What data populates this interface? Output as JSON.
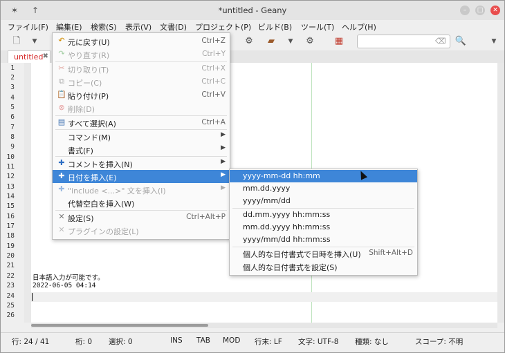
{
  "window": {
    "title": "*untitled - Geany"
  },
  "menubar": [
    "ファイル(F)",
    "編集(E)",
    "検索(S)",
    "表示(V)",
    "文書(D)",
    "プロジェクト(P)",
    "ビルド(B)",
    "ツール(T)",
    "ヘルプ(H)"
  ],
  "tab": {
    "label": "untitled",
    "close": "✖"
  },
  "search": {
    "value": ""
  },
  "editor": {
    "line_numbers": [
      "1",
      "2",
      "3",
      "4",
      "5",
      "6",
      "7",
      "8",
      "9",
      "10",
      "11",
      "12",
      "13",
      "14",
      "15",
      "16",
      "17",
      "18",
      "19",
      "20",
      "21",
      "22",
      "23",
      "24",
      "25",
      "26"
    ],
    "lines": {
      "l22": "日本語入力が可能です。",
      "l23": "2022-06-05 04:14"
    }
  },
  "edit_menu": {
    "undo": {
      "label": "元に戻す(U)",
      "shortcut": "Ctrl+Z"
    },
    "redo": {
      "label": "やり直す(R)",
      "shortcut": "Ctrl+Y"
    },
    "cut": {
      "label": "切り取り(T)",
      "shortcut": "Ctrl+X"
    },
    "copy": {
      "label": "コピー(C)",
      "shortcut": "Ctrl+C"
    },
    "paste": {
      "label": "貼り付け(P)",
      "shortcut": "Ctrl+V"
    },
    "delete": {
      "label": "削除(D)"
    },
    "select_all": {
      "label": "すべて選択(A)",
      "shortcut": "Ctrl+A"
    },
    "commands": {
      "label": "コマンド(M)"
    },
    "format": {
      "label": "書式(F)"
    },
    "insert_comment": {
      "label": "コメントを挿入(N)"
    },
    "insert_date": {
      "label": "日付を挿入(E)"
    },
    "insert_include": {
      "label": "\"include <...>\" 文を挿入(I)"
    },
    "insert_alt_space": {
      "label": "代替空白を挿入(W)"
    },
    "preferences": {
      "label": "設定(S)",
      "shortcut": "Ctrl+Alt+P"
    },
    "plugin_prefs": {
      "label": "プラグインの設定(L)"
    }
  },
  "date_submenu": {
    "items": [
      "yyyy-mm-dd hh:mm",
      "mm.dd.yyyy",
      "yyyy/mm/dd",
      "dd.mm.yyyy hh:mm:ss",
      "mm.dd.yyyy hh:mm:ss",
      "yyyy/mm/dd hh:mm:ss"
    ],
    "custom_insert": {
      "label": "個人的な日付書式で日時を挿入(U)",
      "shortcut": "Shift+Alt+D"
    },
    "custom_set": {
      "label": "個人的な日付書式を設定(S)"
    }
  },
  "statusbar": {
    "line": "行: 24 / 41",
    "col": "桁: 0",
    "sel": "選択: 0",
    "ins": "INS",
    "tab": "TAB",
    "mod": "MOD",
    "eol": "行末: LF",
    "encoding": "文字: UTF-8",
    "filetype": "種類: なし",
    "scope": "スコープ: 不明"
  }
}
